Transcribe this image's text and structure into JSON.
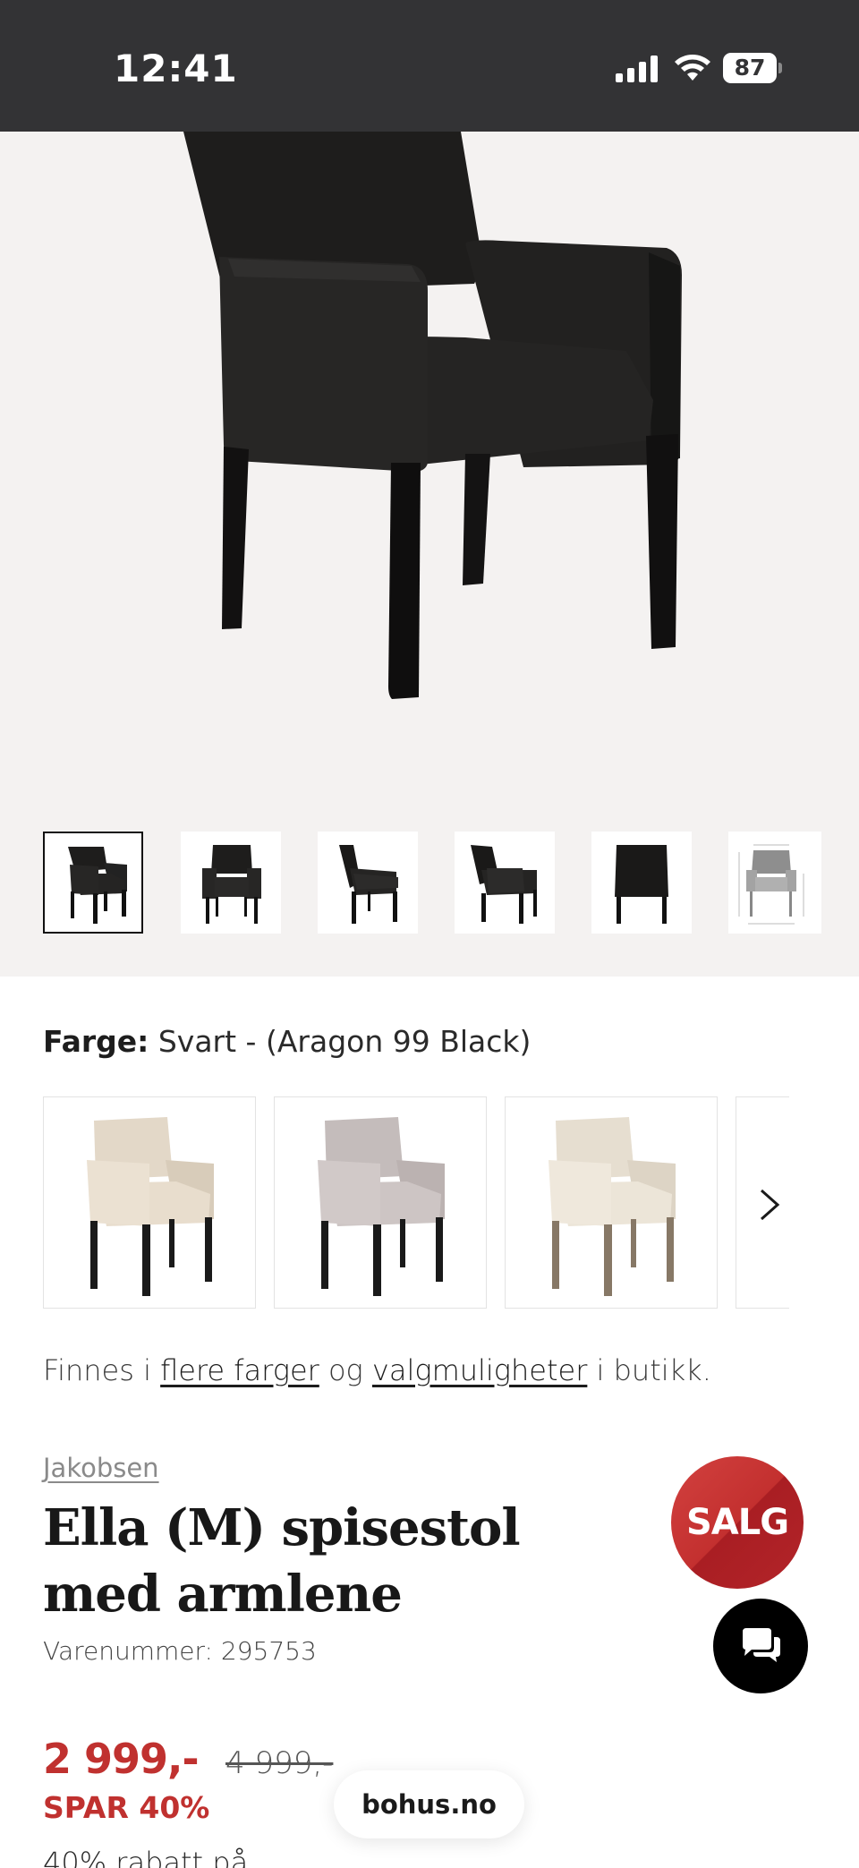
{
  "status_bar": {
    "time": "12:41",
    "battery": "87",
    "icons": [
      "signal-icon",
      "wifi-icon",
      "battery-icon"
    ]
  },
  "gallery": {
    "thumbnails": [
      {
        "name": "front-angle",
        "active": true
      },
      {
        "name": "front",
        "active": false
      },
      {
        "name": "side-left",
        "active": false
      },
      {
        "name": "side-right",
        "active": false
      },
      {
        "name": "back",
        "active": false
      },
      {
        "name": "dimensions",
        "active": false
      }
    ],
    "zoom_icon": "zoom-in-icon",
    "background": "#f4f2f1"
  },
  "color": {
    "label": "Farge:",
    "value": "Svart - (Aragon 99 Black)",
    "swatches": [
      {
        "fabric": "#e3d8c8",
        "legs": "#1a1a1a"
      },
      {
        "fabric": "#cbc3c2",
        "legs": "#1a1a1a"
      },
      {
        "fabric": "#e9e2d5",
        "legs": "#8a7a68"
      }
    ]
  },
  "availability": {
    "prefix": "Finnes i",
    "link1": "flere farger",
    "middle": "og",
    "link2": "valgmuligheter",
    "suffix": "i butikk."
  },
  "product": {
    "brand": "Jakobsen",
    "title": "Ella (M) spisestol med armlene",
    "sku": "Varenummer: 295753",
    "badge": "SALG",
    "price": "2 999,-",
    "old_price": "4 999,-",
    "discount": "SPAR 40%",
    "discount_note": "40% rabatt på"
  },
  "site": {
    "domain": "bohus.no"
  },
  "colors": {
    "accent_red": "#c0312f",
    "status_bar": "#333335",
    "chat_bg": "#000000"
  }
}
